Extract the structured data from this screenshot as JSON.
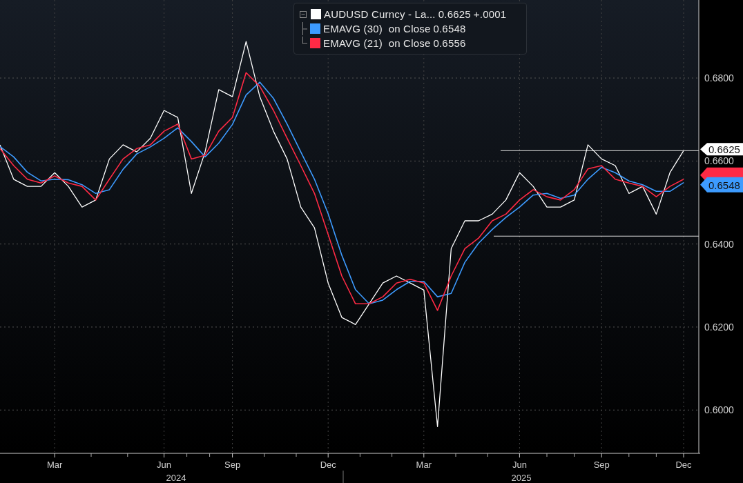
{
  "legend": [
    {
      "value": "0.6625",
      "change": "+.0001"
    },
    {
      "value": "0.6548"
    },
    {
      "value": "0.6556"
    }
  ],
  "year_labels": [
    "2024",
    "2025"
  ],
  "value_tags": [
    "0.6625",
    "0.6548"
  ],
  "chart_data": {
    "type": "line",
    "categories": [
      null,
      null,
      null,
      null,
      "Mar",
      null,
      null,
      null,
      null,
      null,
      null,
      null,
      "Jun",
      null,
      null,
      null,
      null,
      "Sep",
      null,
      null,
      null,
      null,
      null,
      null,
      "Dec",
      null,
      null,
      null,
      null,
      null,
      null,
      "Mar",
      null,
      null,
      null,
      null,
      null,
      null,
      "Jun",
      null,
      null,
      null,
      null,
      null,
      "Sep",
      null,
      null,
      null,
      null,
      null,
      "Dec"
    ],
    "ylim": [
      0.5899,
      0.6988
    ],
    "grid": true,
    "ref_lines": [
      {
        "axis": "y",
        "value": 0.6625
      },
      {
        "axis": "y",
        "value": 0.6419
      }
    ],
    "yticks": [
      {
        "value": 0.6,
        "label": "0.6000"
      },
      {
        "value": 0.62,
        "label": "0.6200"
      },
      {
        "value": 0.64,
        "label": "0.6400"
      },
      {
        "value": 0.66,
        "label": "0.6600"
      },
      {
        "value": 0.68,
        "label": "0.6800"
      }
    ],
    "series": [
      {
        "name": "AUDUSD Curncy - La...",
        "color": "#ffffff",
        "values": [
          0.6639,
          0.6556,
          0.6539,
          0.6539,
          0.6572,
          0.6539,
          0.6489,
          0.6506,
          0.6605,
          0.6639,
          0.6622,
          0.6655,
          0.6722,
          0.6705,
          0.6522,
          0.6622,
          0.6772,
          0.6755,
          0.6888,
          0.6755,
          0.6672,
          0.6605,
          0.6489,
          0.6439,
          0.6306,
          0.6223,
          0.6206,
          0.6256,
          0.6306,
          0.6323,
          0.6306,
          0.6289,
          0.596,
          0.6389,
          0.6456,
          0.6456,
          0.6472,
          0.6506,
          0.6572,
          0.6539,
          0.6489,
          0.6489,
          0.6506,
          0.6639,
          0.6605,
          0.6589,
          0.6522,
          0.6539,
          0.6472,
          0.6572,
          0.6625
        ]
      },
      {
        "name": "EMAVG (30)  on Close",
        "color": "#3d9bff",
        "values": [
          0.6635,
          0.661,
          0.6573,
          0.6552,
          0.6556,
          0.6555,
          0.6543,
          0.6522,
          0.6531,
          0.658,
          0.6617,
          0.6634,
          0.6655,
          0.668,
          0.6647,
          0.661,
          0.6643,
          0.6688,
          0.6759,
          0.679,
          0.6751,
          0.6689,
          0.6622,
          0.6556,
          0.6473,
          0.6373,
          0.629,
          0.6256,
          0.6265,
          0.629,
          0.631,
          0.631,
          0.6273,
          0.6281,
          0.6356,
          0.6402,
          0.6435,
          0.6464,
          0.6489,
          0.6518,
          0.6522,
          0.651,
          0.6518,
          0.6556,
          0.6585,
          0.6572,
          0.6552,
          0.6543,
          0.6527,
          0.6527,
          0.6548
        ]
      },
      {
        "name": "EMAVG (21)  on Close",
        "color": "#ff2a45",
        "values": [
          0.663,
          0.6589,
          0.6556,
          0.6547,
          0.6564,
          0.6547,
          0.6539,
          0.6506,
          0.6556,
          0.6605,
          0.663,
          0.6639,
          0.6672,
          0.6689,
          0.6605,
          0.6614,
          0.6672,
          0.6705,
          0.6813,
          0.678,
          0.6722,
          0.6655,
          0.6589,
          0.6522,
          0.6423,
          0.6323,
          0.6256,
          0.6256,
          0.6273,
          0.6306,
          0.6315,
          0.6306,
          0.624,
          0.6323,
          0.6389,
          0.6414,
          0.6456,
          0.6472,
          0.6506,
          0.6531,
          0.6514,
          0.6506,
          0.6531,
          0.6581,
          0.6589,
          0.6556,
          0.6547,
          0.6539,
          0.6514,
          0.6539,
          0.6556
        ]
      }
    ]
  }
}
